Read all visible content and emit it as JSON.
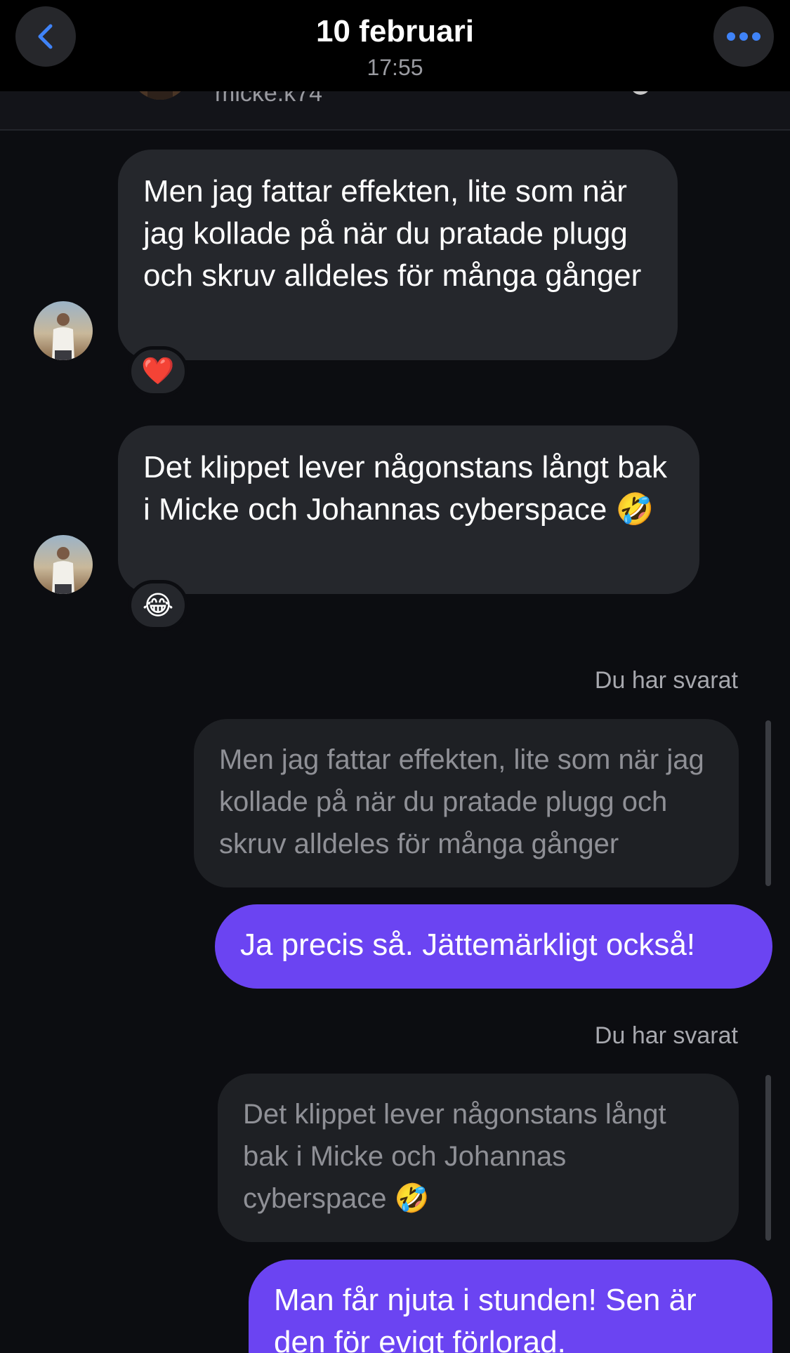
{
  "header": {
    "title": "10 februari",
    "time": "17:55",
    "back_icon": "chevron-left-icon",
    "more_icon": "ellipsis-icon"
  },
  "peek": {
    "name": "micke.k74"
  },
  "messages": [
    {
      "text": "Men jag fattar effekten, lite som när jag kollade på när du pratade plugg och skruv alldeles för många gånger",
      "reaction": "❤️"
    },
    {
      "text": "Det klippet lever någonstans långt bak i Micke och Johannas cyberspace 🤣",
      "reaction": "😂"
    }
  ],
  "replies": [
    {
      "label": "Du har svarat",
      "quoted": "Men jag fattar effekten, lite som när jag kollade på när du pratade plugg och skruv alldeles för många gånger",
      "text": "Ja precis så. Jättemärkligt också!"
    },
    {
      "label": "Du har svarat",
      "quoted": "Det klippet lever någonstans långt bak i Micke och Johannas cyberspace 🤣",
      "text": "Man får njuta i stunden! Sen är den för evigt förlorad."
    }
  ],
  "colors": {
    "accent": "#6b44f2",
    "link_blue": "#3f83f8",
    "background": "#0c0d11",
    "bubble_in": "#25272c"
  }
}
